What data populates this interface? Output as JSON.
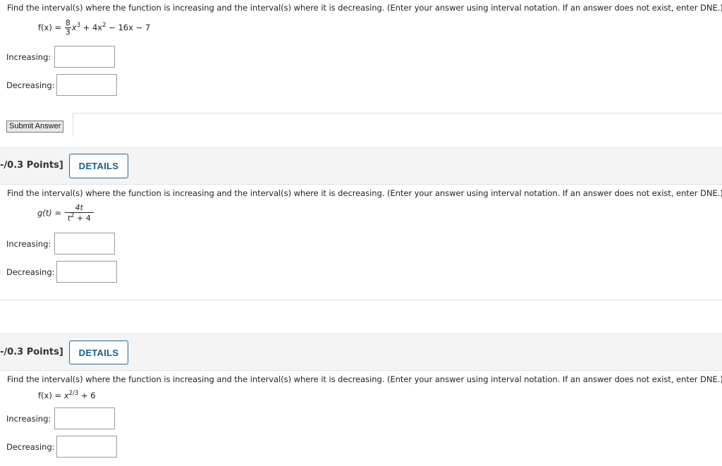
{
  "q1": {
    "prompt": "Find the interval(s) where the function is increasing and the interval(s) where it is decreasing. (Enter your answer using interval notation. If an answer does not exist, enter DNE.)",
    "fn_name": "f(x)",
    "frac_num": "8",
    "frac_den": "3",
    "term1_var": "x",
    "term1_exp": "3",
    "term2": "+ 4x",
    "term2_exp": "2",
    "rest": "− 16x − 7",
    "increasing_label": "Increasing:",
    "decreasing_label": "Decreasing:",
    "increasing_value": "",
    "decreasing_value": "",
    "submit_label": "Submit Answer"
  },
  "q2": {
    "points": "-/0.3 Points]",
    "details_label": "DETAILS",
    "prompt": "Find the interval(s) where the function is increasing and the interval(s) where it is decreasing. (Enter your answer using interval notation. If an answer does not exist, enter DNE.)",
    "fn_name": "g(t)",
    "frac_num": "4t",
    "frac_den_var": "t",
    "frac_den_exp": "2",
    "frac_den_rest": "+ 4",
    "increasing_label": "Increasing:",
    "decreasing_label": "Decreasing:",
    "increasing_value": "",
    "decreasing_value": ""
  },
  "q3": {
    "points": "-/0.3 Points]",
    "details_label": "DETAILS",
    "prompt": "Find the interval(s) where the function is increasing and the interval(s) where it is decreasing. (Enter your answer using interval notation. If an answer does not exist, enter DNE.)",
    "fn_name": "f(x)",
    "base": "x",
    "exp": "2/3",
    "rest": "+ 6",
    "increasing_label": "Increasing:",
    "decreasing_label": "Decreasing:",
    "increasing_value": "",
    "decreasing_value": ""
  }
}
